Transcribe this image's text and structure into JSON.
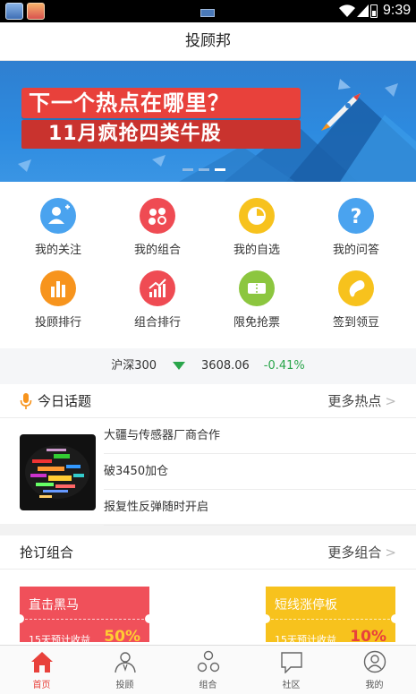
{
  "status_bar": {
    "time": "9:39"
  },
  "header": {
    "title": "投顾邦"
  },
  "banner": {
    "line1": "下一个热点在哪里？",
    "line2": "11月疯抢四类牛股",
    "page_count": 3,
    "active_page": 3
  },
  "menu": {
    "items": [
      {
        "label": "我的关注",
        "icon": "user-plus-icon",
        "color": "#4aa3ef"
      },
      {
        "label": "我的组合",
        "icon": "combination-icon",
        "color": "#ef4b53"
      },
      {
        "label": "我的自选",
        "icon": "pie-icon",
        "color": "#f7c21d"
      },
      {
        "label": "我的问答",
        "icon": "question-icon",
        "color": "#4aa3ef"
      },
      {
        "label": "投顾排行",
        "icon": "bar-chart-icon",
        "color": "#f7941d"
      },
      {
        "label": "组合排行",
        "icon": "trend-icon",
        "color": "#ef4b53"
      },
      {
        "label": "限免抢票",
        "icon": "ticket-icon",
        "color": "#8cc63f"
      },
      {
        "label": "签到领豆",
        "icon": "bean-icon",
        "color": "#f7c21d"
      }
    ]
  },
  "index": {
    "name": "沪深300",
    "value": "3608.06",
    "change": "-0.41%",
    "trend_color": "#2aa54b"
  },
  "topics": {
    "title": "今日话题",
    "more": "更多热点",
    "items": [
      "大疆与传感器厂商合作",
      "破3450加仓",
      "报复性反弹随时开启"
    ]
  },
  "plans": {
    "title": "抢订组合",
    "more": "更多组合",
    "cards": [
      {
        "name": "直击黑马",
        "sub": "15天预计收益",
        "value": "50%",
        "color": "#f0505a"
      },
      {
        "name": "短线涨停板",
        "sub": "15天预计收益",
        "value": "10%",
        "color": "#f7c21d"
      }
    ]
  },
  "bottom_nav": {
    "items": [
      {
        "label": "首页",
        "icon": "home-icon",
        "active": true
      },
      {
        "label": "投顾",
        "icon": "advisor-icon",
        "active": false
      },
      {
        "label": "组合",
        "icon": "combination-icon",
        "active": false
      },
      {
        "label": "社区",
        "icon": "community-icon",
        "active": false
      },
      {
        "label": "我的",
        "icon": "profile-icon",
        "active": false
      }
    ]
  }
}
